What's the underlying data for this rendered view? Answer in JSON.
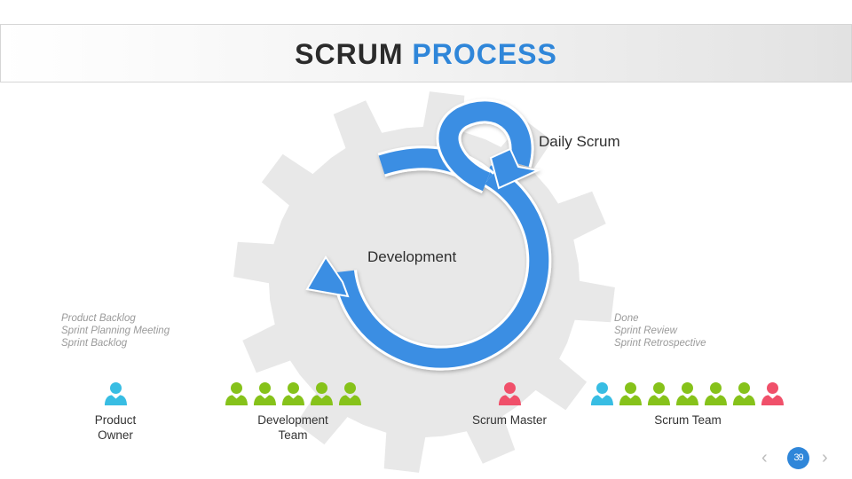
{
  "header": {
    "title_part1": "SCRUM",
    "title_part2": "PROCESS"
  },
  "colors": {
    "accent_blue": "#2f86d9",
    "arrow_blue": "#3b8ee3",
    "gear_gray": "#e8e8e8",
    "product_owner": "#38bde3",
    "dev_team": "#86c21a",
    "scrum_master": "#f0506a"
  },
  "diagram": {
    "daily_scrum_label": "Daily Scrum",
    "development_label": "Development",
    "left_notes": [
      "Product Backlog",
      "Sprint Planning Meeting",
      "Sprint Backlog"
    ],
    "right_notes": [
      "Done",
      "Sprint Review",
      "Sprint Retrospective"
    ]
  },
  "roles": [
    {
      "label_line1": "Product",
      "label_line2": "Owner",
      "icons": [
        "person-blue"
      ]
    },
    {
      "label_line1": "Development",
      "label_line2": "Team",
      "icons": [
        "person-green",
        "person-green",
        "person-green",
        "person-green",
        "person-green"
      ]
    },
    {
      "label_line1": "Scrum Master",
      "label_line2": "",
      "icons": [
        "person-red"
      ]
    },
    {
      "label_line1": "Scrum Team",
      "label_line2": "",
      "icons": [
        "person-blue",
        "person-green",
        "person-green",
        "person-green",
        "person-green",
        "person-green",
        "person-red"
      ]
    }
  ],
  "pager": {
    "prev_icon": "chevron-left-icon",
    "next_icon": "chevron-right-icon",
    "page_number": "39"
  }
}
